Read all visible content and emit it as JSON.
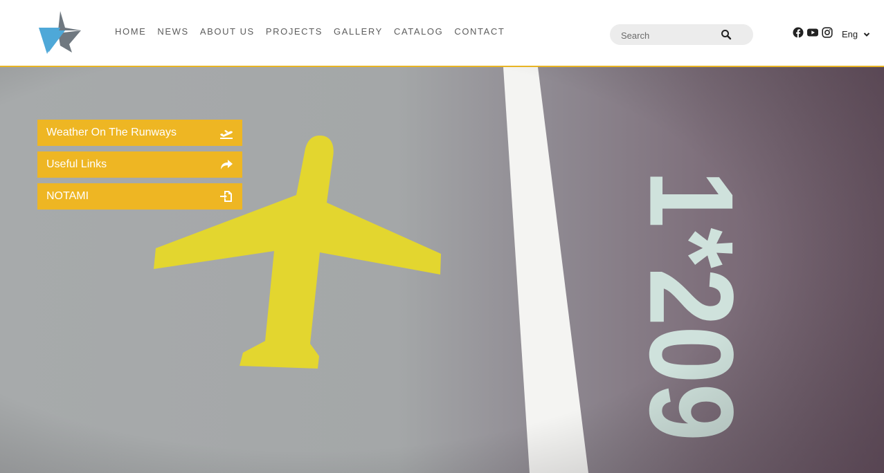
{
  "nav": {
    "items": [
      "HOME",
      "NEWS",
      "ABOUT US",
      "PROJECTS",
      "GALLERY",
      "CATALOG",
      "CONTACT"
    ]
  },
  "search": {
    "placeholder": "Search",
    "icon": "search-icon"
  },
  "socials": {
    "icons": [
      "facebook-icon",
      "youtube-icon",
      "instagram-icon"
    ]
  },
  "language": {
    "selected": "Eng"
  },
  "quick_links": {
    "items": [
      {
        "label": "Weather On The Runways",
        "icon": "plane-departure-icon"
      },
      {
        "label": "Useful Links",
        "icon": "share-icon"
      },
      {
        "label": "NOTAMI",
        "icon": "file-import-icon"
      }
    ]
  },
  "hero": {
    "runway_marking": "1*209"
  },
  "colors": {
    "accent": "#eeb623",
    "logo_blue": "#4ea8d8",
    "logo_gray": "#6f7880",
    "border": "#e8b423"
  }
}
